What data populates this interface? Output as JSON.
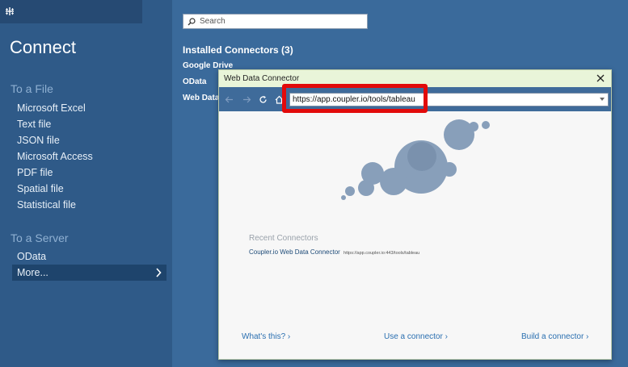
{
  "sidebar": {
    "title": "Connect",
    "file_section": "To a File",
    "file_items": [
      "Microsoft Excel",
      "Text file",
      "JSON file",
      "Microsoft Access",
      "PDF file",
      "Spatial file",
      "Statistical file"
    ],
    "server_section": "To a Server",
    "server_items": [
      "OData",
      "More..."
    ]
  },
  "search": {
    "placeholder": "Search",
    "value": ""
  },
  "installed": {
    "heading": "Installed Connectors (3)",
    "items": [
      "Google Drive",
      "OData",
      "Web Data"
    ]
  },
  "dialog": {
    "title": "Web Data Connector",
    "url": "https://app.coupler.io/tools/tableau",
    "recent_heading": "Recent Connectors",
    "recent_name": "Coupler.io Web Data Connector",
    "recent_url": "https://app.coupler.io:443/tools/tableau",
    "footer": {
      "whats_this": "What's this? ›",
      "use_connector": "Use a connector ›",
      "build_connector": "Build a connector ›"
    }
  },
  "colors": {
    "highlight": "#e20a0a",
    "sidebar_bg": "#2f5a88",
    "dialog_titlebar": "#e9f5d9"
  },
  "icons": [
    "logo-icon",
    "search-icon",
    "chevron-right-icon",
    "close-icon",
    "back-icon",
    "forward-icon",
    "refresh-icon",
    "home-icon",
    "dropdown-icon"
  ]
}
